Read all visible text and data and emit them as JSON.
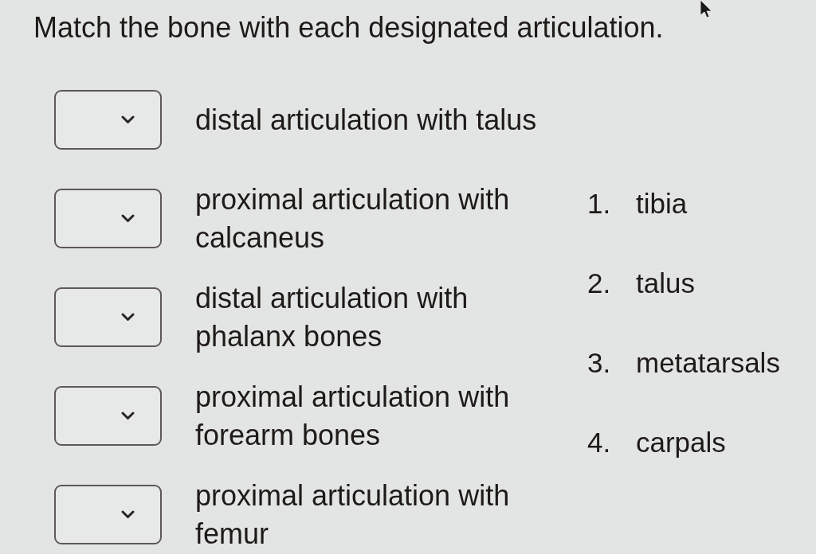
{
  "question": "Match the bone with each designated articulation.",
  "prompts": [
    {
      "text": "distal articulation with talus"
    },
    {
      "text": "proximal articulation with calcaneus"
    },
    {
      "text": "distal articulation with phalanx bones"
    },
    {
      "text": "proximal articulation with forearm bones"
    },
    {
      "text": "proximal articulation with femur"
    }
  ],
  "options": [
    {
      "number": "1.",
      "label": "tibia"
    },
    {
      "number": "2.",
      "label": "talus"
    },
    {
      "number": "3.",
      "label": "metatarsals"
    },
    {
      "number": "4.",
      "label": "carpals"
    }
  ]
}
